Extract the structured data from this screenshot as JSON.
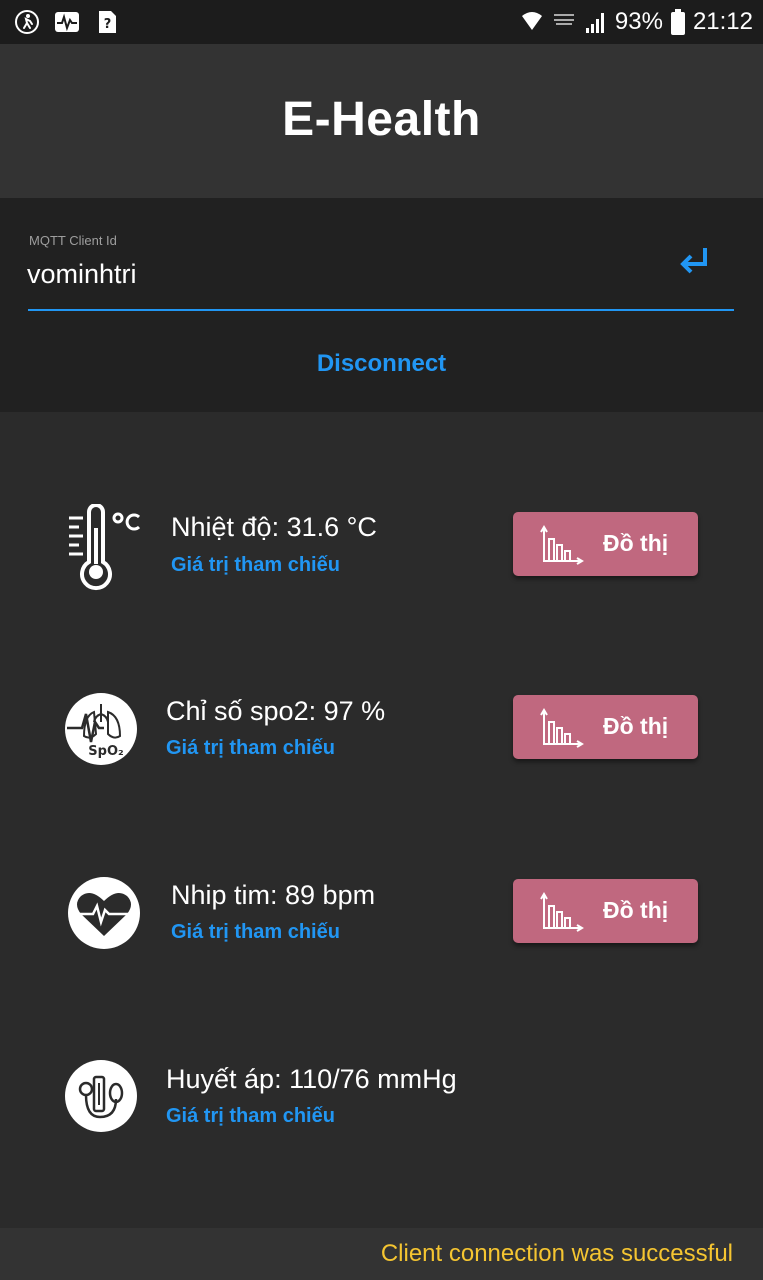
{
  "status_bar": {
    "left_icons": [
      "running-icon",
      "activity-icon",
      "unknown-app-icon"
    ],
    "battery_percent": "93%",
    "time": "21:12"
  },
  "app": {
    "title": "E-Health"
  },
  "mqtt": {
    "label": "MQTT Client Id",
    "client_id": "vominhtri",
    "disconnect_label": "Disconnect",
    "accent": "#2196f3"
  },
  "metrics": [
    {
      "icon": "thermometer-icon",
      "value": "Nhiệt độ: 31.6 °C",
      "reference_label": "Giá trị tham chiếu",
      "graph_label": "Đồ thị"
    },
    {
      "icon": "lungs-spo2-icon",
      "value": "Chỉ số spo2: 97 %",
      "reference_label": "Giá trị tham chiếu",
      "graph_label": "Đồ thị"
    },
    {
      "icon": "heart-rate-icon",
      "value": "Nhip tim: 89 bpm",
      "reference_label": "Giá trị tham chiếu",
      "graph_label": "Đồ thị"
    },
    {
      "icon": "blood-pressure-icon",
      "value": "Huyết áp: 110/76 mmHg",
      "reference_label": "Giá trị tham chiếu"
    }
  ],
  "graph_button_color": "#c0687f",
  "snackbar": {
    "message": "Client connection was successful",
    "color": "#f5c531"
  }
}
